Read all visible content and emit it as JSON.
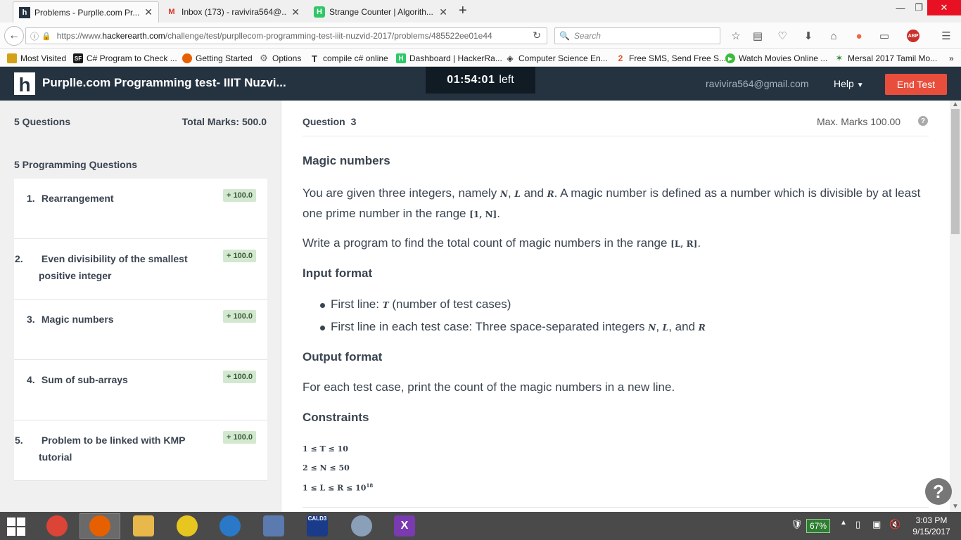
{
  "browser": {
    "tabs": [
      {
        "label": "Problems - Purplle.com Pr...",
        "icon": "hackerearth-icon",
        "active": true
      },
      {
        "label": "Inbox (173) - ravivira564@...",
        "icon": "gmail-icon",
        "active": false
      },
      {
        "label": "Strange Counter | Algorith...",
        "icon": "hackerrank-icon",
        "active": false
      }
    ],
    "url": {
      "prefix": "https://www.",
      "domain": "hackerearth.com",
      "path": "/challenge/test/purpllecom-programming-test-iiit-nuzvid-2017/problems/485522ee01e44"
    },
    "search_placeholder": "Search",
    "bookmarks": [
      {
        "label": "Most Visited",
        "icon": "folder-icon",
        "color": "#d4a017"
      },
      {
        "label": "C# Program to Check ...",
        "icon": "sf-icon",
        "color": "#1a1a1a"
      },
      {
        "label": "Getting Started",
        "icon": "firefox-icon",
        "color": "#e66000"
      },
      {
        "label": "Options",
        "icon": "gear-icon",
        "color": "#666666"
      },
      {
        "label": "compile c# online",
        "icon": "t-icon",
        "color": "#222222"
      },
      {
        "label": "Dashboard | HackerRa...",
        "icon": "hackerrank-icon",
        "color": "#2ec866"
      },
      {
        "label": "Computer Science En...",
        "icon": "eye-icon",
        "color": "#333333"
      },
      {
        "label": "Free SMS, Send Free S...",
        "icon": "way2sms-icon",
        "color": "#e8501f"
      },
      {
        "label": "Watch Movies Online ...",
        "icon": "play-icon",
        "color": "#3cbc3c"
      },
      {
        "label": "Mersal 2017 Tamil Mo...",
        "icon": "star-icon",
        "color": "#3a8a3a"
      }
    ],
    "overflow": "»"
  },
  "app": {
    "logo_letter": "h",
    "title": "Purplle.com Programming test- IIIT Nuzvi...",
    "timer_value": "01:54:01",
    "timer_suffix": "left",
    "user_email": "ravivira564@gmail.com",
    "help_label": "Help",
    "end_test_label": "End Test"
  },
  "sidebar": {
    "question_count": "5 Questions",
    "total_marks": "Total Marks: 500.0",
    "programming_heading": "5 Programming Questions",
    "questions": [
      {
        "num": "1.",
        "title": "Rearrangement",
        "marks": "+ 100.0"
      },
      {
        "num": "2.",
        "title": "Even divisibility of the smallest positive integer",
        "marks": "+ 100.0"
      },
      {
        "num": "3.",
        "title": "Magic numbers",
        "marks": "+ 100.0"
      },
      {
        "num": "4.",
        "title": "Sum of sub-arrays",
        "marks": "+ 100.0"
      },
      {
        "num": "5.",
        "title": "Problem to be linked with KMP tutorial",
        "marks": "+ 100.0"
      }
    ]
  },
  "question": {
    "label": "Question",
    "number": "3",
    "max_marks": "Max. Marks 100.00",
    "title": "Magic numbers",
    "p1_a": "You are given three integers, namely ",
    "p1_n": "N",
    "p1_b": ", ",
    "p1_l": "L",
    "p1_c": " and ",
    "p1_r": "R",
    "p1_d": ". A magic number is defined as a number which is divisible by at least one prime number in the range ",
    "p1_range": "[1, N]",
    "p1_e": ".",
    "p2_a": "Write a program to find the total count of magic numbers in the range ",
    "p2_range": "[L, R]",
    "p2_b": ".",
    "input_heading": "Input format",
    "input_b1_a": "First line: ",
    "input_b1_t": "T",
    "input_b1_b": " (number of test cases)",
    "input_b2_a": "First line in each test case: Three space-separated integers ",
    "input_b2_n": "N",
    "input_b2_b": ", ",
    "input_b2_l": "L",
    "input_b2_c": ", and ",
    "input_b2_r": "R",
    "output_heading": "Output format",
    "output_text": "For each test case, print the count of the magic numbers in a new line.",
    "constraints_heading": "Constraints",
    "constraints": [
      "1 ≤ T ≤ 10",
      "2 ≤ N ≤ 50",
      "1 ≤ L ≤ R ≤ 10"
    ],
    "constraint3_exp": "18"
  },
  "taskbar": {
    "apps": [
      {
        "name": "chrome-icon",
        "color": "#db4437"
      },
      {
        "name": "firefox-icon",
        "color": "#e66000"
      },
      {
        "name": "file-explorer-icon",
        "color": "#e8b84a"
      },
      {
        "name": "pikachu-icon",
        "color": "#e8c620"
      },
      {
        "name": "globe-icon",
        "color": "#2a78c8"
      },
      {
        "name": "computer-icon",
        "color": "#5a7ab0"
      },
      {
        "name": "cald3-icon",
        "color": "#1a3a8a",
        "label": "CALD3"
      },
      {
        "name": "magnifier-icon",
        "color": "#8aa0b8"
      },
      {
        "name": "x-app-icon",
        "color": "#7a3ab0"
      }
    ],
    "battery": "67%",
    "time": "3:03 PM",
    "date": "9/15/2017"
  }
}
